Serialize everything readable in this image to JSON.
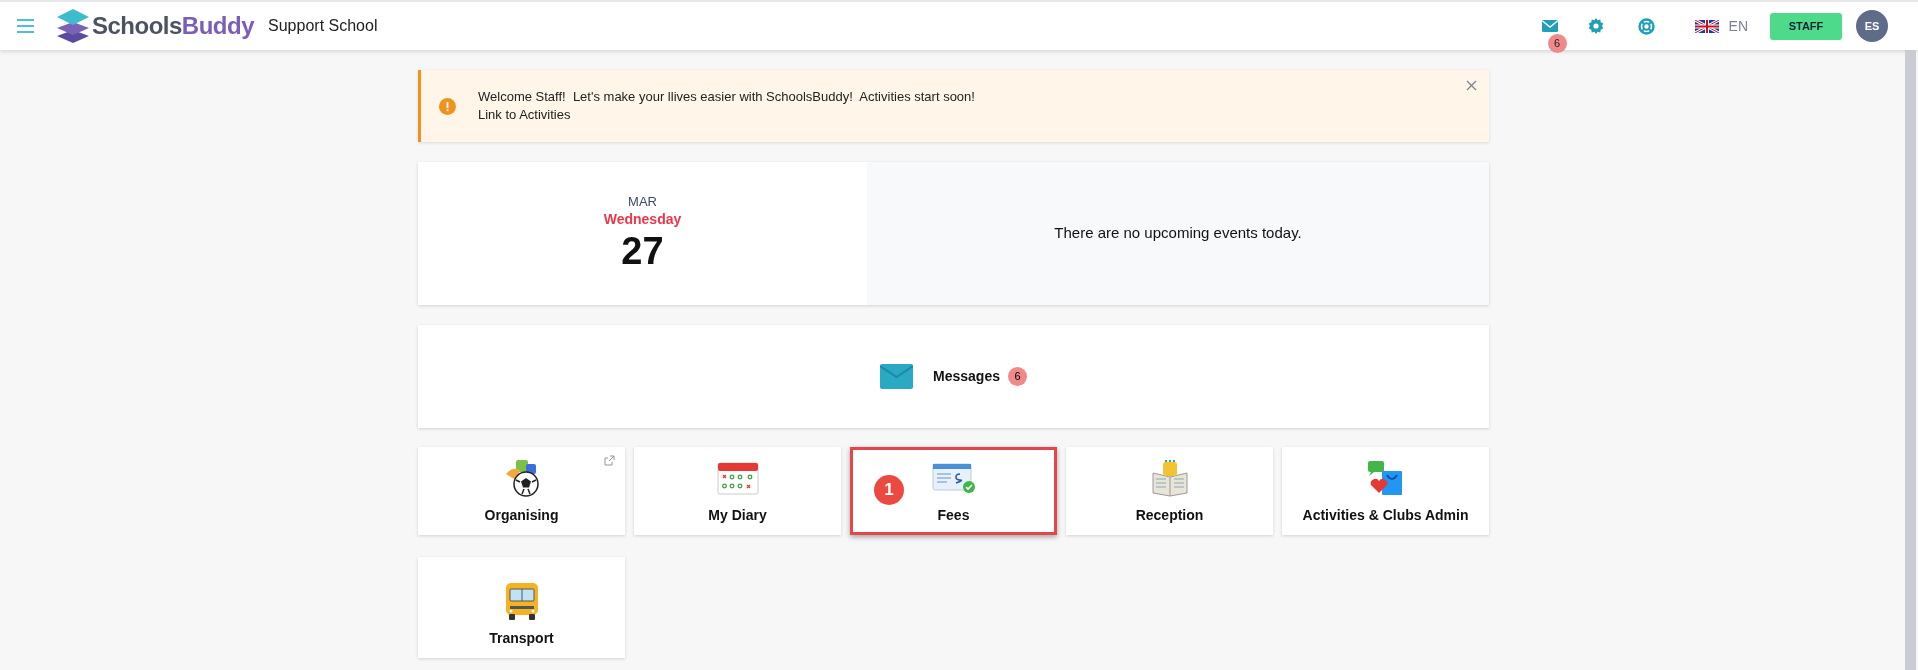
{
  "header": {
    "logo_text": [
      "Schools",
      "Buddy"
    ],
    "school_name": "Support School",
    "mail_badge": "6",
    "language": "EN",
    "role_button": "STAFF",
    "avatar_initials": "ES"
  },
  "alert": {
    "message": "Welcome Staff!  Let's make your llives easier with SchoolsBuddy!  Activities start soon!",
    "link": "Link to Activities"
  },
  "date_card": {
    "month": "MAR",
    "weekday": "Wednesday",
    "day": "27",
    "events_text": "There are no upcoming events today."
  },
  "messages_card": {
    "label": "Messages",
    "count": "6"
  },
  "tiles": [
    {
      "kind": "organising",
      "label": "Organising",
      "external": true,
      "highlighted": false
    },
    {
      "kind": "diary",
      "label": "My Diary",
      "external": false,
      "highlighted": false
    },
    {
      "kind": "fees",
      "label": "Fees",
      "external": false,
      "highlighted": true,
      "step": "1"
    },
    {
      "kind": "reception",
      "label": "Reception",
      "external": false,
      "highlighted": false
    },
    {
      "kind": "activities",
      "label": "Activities & Clubs Admin",
      "external": false,
      "highlighted": false
    },
    {
      "kind": "transport",
      "label": "Transport",
      "external": false,
      "highlighted": false
    }
  ]
}
